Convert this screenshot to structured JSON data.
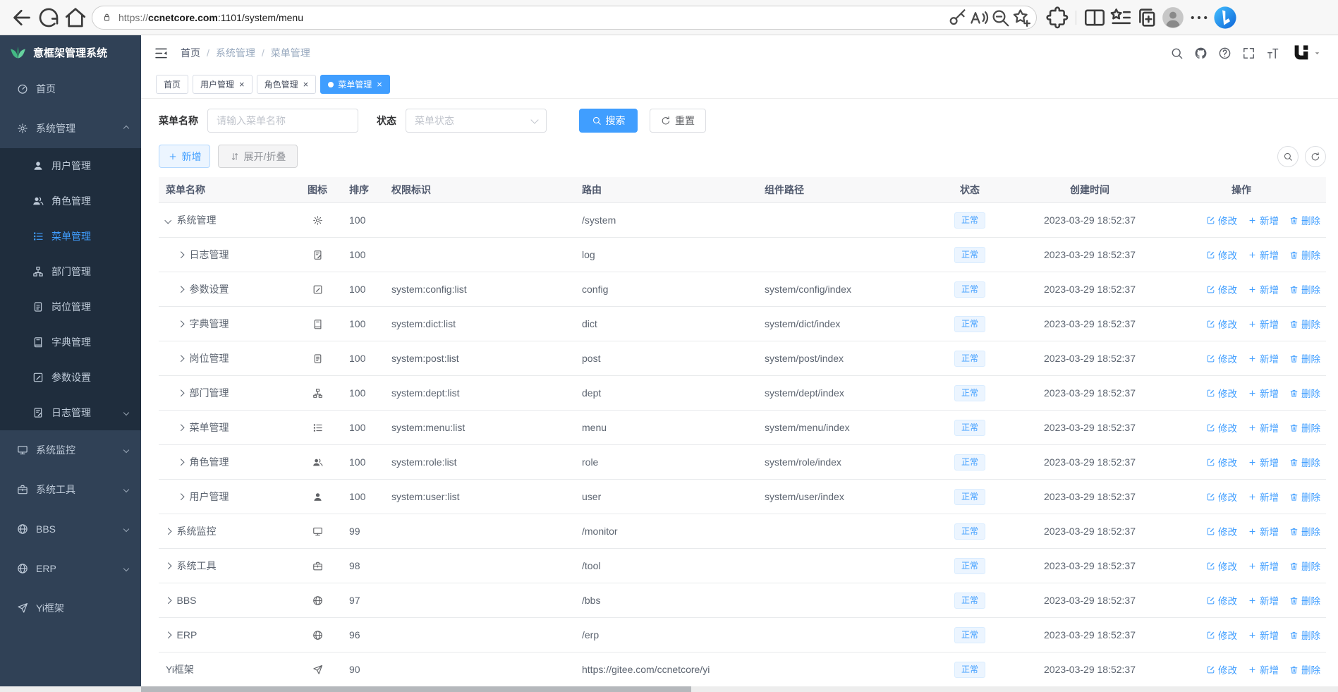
{
  "colors": {
    "primary": "#409eff",
    "sidebar_bg": "#304156",
    "submenu_bg": "#1f2d3d",
    "status_bg": "#ecf5ff",
    "status_border": "#d9ecff"
  },
  "browser": {
    "url_scheme": "https://",
    "url_host": "ccnetcore.com",
    "url_rest": ":1101/system/menu",
    "left_tools": [
      "back-icon",
      "reload-icon",
      "home-icon"
    ],
    "pill_tools": [
      "key-icon",
      "read-aloud-icon",
      "zoom-out-icon",
      "favorite-add-icon"
    ],
    "right_tools": [
      "extensions-icon",
      "split-screen-icon",
      "favorites-bar-icon",
      "collections-icon",
      "profile-icon",
      "more-icon",
      "bing-icon"
    ]
  },
  "sidebar": {
    "logo_text": "意框架管理系统",
    "items": [
      {
        "key": "home",
        "label": "首页",
        "icon": "dashboard-icon"
      },
      {
        "key": "system",
        "label": "系统管理",
        "icon": "gear-icon",
        "expanded": true,
        "children": [
          {
            "key": "user",
            "label": "用户管理",
            "icon": "user-icon"
          },
          {
            "key": "role",
            "label": "角色管理",
            "icon": "users-icon"
          },
          {
            "key": "menu",
            "label": "菜单管理",
            "icon": "menu-icon",
            "active": true
          },
          {
            "key": "dept",
            "label": "部门管理",
            "icon": "tree-icon"
          },
          {
            "key": "post",
            "label": "岗位管理",
            "icon": "post-icon"
          },
          {
            "key": "dict",
            "label": "字典管理",
            "icon": "dict-icon"
          },
          {
            "key": "config",
            "label": "参数设置",
            "icon": "edit-icon"
          },
          {
            "key": "log",
            "label": "日志管理",
            "icon": "log-icon",
            "chevron": true
          }
        ]
      },
      {
        "key": "monitor",
        "label": "系统监控",
        "icon": "monitor-icon",
        "chevron": true
      },
      {
        "key": "tool",
        "label": "系统工具",
        "icon": "tool-icon",
        "chevron": true
      },
      {
        "key": "bbs",
        "label": "BBS",
        "icon": "globe-icon",
        "chevron": true
      },
      {
        "key": "erp",
        "label": "ERP",
        "icon": "globe-icon",
        "chevron": true
      },
      {
        "key": "yi",
        "label": "Yi框架",
        "icon": "send-icon"
      }
    ]
  },
  "header": {
    "breadcrumb": [
      "首页",
      "系统管理",
      "菜单管理"
    ],
    "breadcrumb_separator": "/",
    "tools": [
      "search-icon",
      "github-icon",
      "question-icon",
      "fullscreen-icon",
      "font-size-icon"
    ],
    "logo_icon": "yi-logo-icon"
  },
  "tabs": [
    {
      "key": "home",
      "label": "首页",
      "closable": false,
      "active": false
    },
    {
      "key": "user",
      "label": "用户管理",
      "closable": true,
      "active": false
    },
    {
      "key": "role",
      "label": "角色管理",
      "closable": true,
      "active": false
    },
    {
      "key": "menu",
      "label": "菜单管理",
      "closable": true,
      "active": true
    }
  ],
  "search": {
    "name_label": "菜单名称",
    "name_placeholder": "请输入菜单名称",
    "name_value": "",
    "status_label": "状态",
    "status_placeholder": "菜单状态",
    "search_button": "搜索",
    "reset_button": "重置"
  },
  "toolbar": {
    "add_label": "新增",
    "expand_label": "展开/折叠"
  },
  "table": {
    "columns": [
      "菜单名称",
      "图标",
      "排序",
      "权限标识",
      "路由",
      "组件路径",
      "状态",
      "创建时间",
      "操作"
    ],
    "actions": [
      {
        "key": "edit",
        "label": "修改",
        "icon": "edit-square-icon"
      },
      {
        "key": "add",
        "label": "新增",
        "icon": "plus-icon"
      },
      {
        "key": "delete",
        "label": "删除",
        "icon": "trash-icon"
      }
    ],
    "rows": [
      {
        "name": "系统管理",
        "icon": "gear-icon",
        "expand": "down",
        "child": false,
        "sort": "100",
        "perm": "",
        "route": "/system",
        "component": "",
        "status": "正常",
        "created": "2023-03-29 18:52:37"
      },
      {
        "name": "日志管理",
        "icon": "log-icon",
        "expand": "right",
        "child": true,
        "sort": "100",
        "perm": "",
        "route": "log",
        "component": "",
        "status": "正常",
        "created": "2023-03-29 18:52:37"
      },
      {
        "name": "参数设置",
        "icon": "edit-icon",
        "expand": "right",
        "child": true,
        "sort": "100",
        "perm": "system:config:list",
        "route": "config",
        "component": "system/config/index",
        "status": "正常",
        "created": "2023-03-29 18:52:37"
      },
      {
        "name": "字典管理",
        "icon": "dict-icon",
        "expand": "right",
        "child": true,
        "sort": "100",
        "perm": "system:dict:list",
        "route": "dict",
        "component": "system/dict/index",
        "status": "正常",
        "created": "2023-03-29 18:52:37"
      },
      {
        "name": "岗位管理",
        "icon": "post-icon",
        "expand": "right",
        "child": true,
        "sort": "100",
        "perm": "system:post:list",
        "route": "post",
        "component": "system/post/index",
        "status": "正常",
        "created": "2023-03-29 18:52:37"
      },
      {
        "name": "部门管理",
        "icon": "tree-icon",
        "expand": "right",
        "child": true,
        "sort": "100",
        "perm": "system:dept:list",
        "route": "dept",
        "component": "system/dept/index",
        "status": "正常",
        "created": "2023-03-29 18:52:37"
      },
      {
        "name": "菜单管理",
        "icon": "menu-icon",
        "expand": "right",
        "child": true,
        "sort": "100",
        "perm": "system:menu:list",
        "route": "menu",
        "component": "system/menu/index",
        "status": "正常",
        "created": "2023-03-29 18:52:37"
      },
      {
        "name": "角色管理",
        "icon": "users-icon",
        "expand": "right",
        "child": true,
        "sort": "100",
        "perm": "system:role:list",
        "route": "role",
        "component": "system/role/index",
        "status": "正常",
        "created": "2023-03-29 18:52:37"
      },
      {
        "name": "用户管理",
        "icon": "user-icon",
        "expand": "right",
        "child": true,
        "sort": "100",
        "perm": "system:user:list",
        "route": "user",
        "component": "system/user/index",
        "status": "正常",
        "created": "2023-03-29 18:52:37"
      },
      {
        "name": "系统监控",
        "icon": "monitor-icon",
        "expand": "right",
        "child": false,
        "sort": "99",
        "perm": "",
        "route": "/monitor",
        "component": "",
        "status": "正常",
        "created": "2023-03-29 18:52:37"
      },
      {
        "name": "系统工具",
        "icon": "tool-icon",
        "expand": "right",
        "child": false,
        "sort": "98",
        "perm": "",
        "route": "/tool",
        "component": "",
        "status": "正常",
        "created": "2023-03-29 18:52:37"
      },
      {
        "name": "BBS",
        "icon": "globe-icon",
        "expand": "right",
        "child": false,
        "sort": "97",
        "perm": "",
        "route": "/bbs",
        "component": "",
        "status": "正常",
        "created": "2023-03-29 18:52:37"
      },
      {
        "name": "ERP",
        "icon": "globe-icon",
        "expand": "right",
        "child": false,
        "sort": "96",
        "perm": "",
        "route": "/erp",
        "component": "",
        "status": "正常",
        "created": "2023-03-29 18:52:37"
      },
      {
        "name": "Yi框架",
        "icon": "send-icon",
        "expand": "none",
        "child": false,
        "sort": "90",
        "perm": "",
        "route": "https://gitee.com/ccnetcore/yi",
        "component": "",
        "status": "正常",
        "created": "2023-03-29 18:52:37"
      }
    ]
  }
}
